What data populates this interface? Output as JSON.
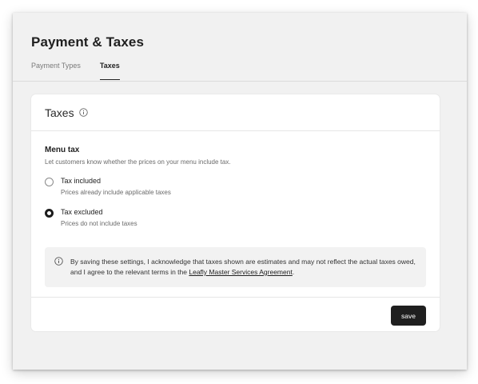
{
  "page": {
    "title": "Payment & Taxes",
    "tabs": [
      {
        "label": "Payment Types",
        "active": false
      },
      {
        "label": "Taxes",
        "active": true
      }
    ]
  },
  "card": {
    "title": "Taxes",
    "title_icon": "info-icon",
    "section": {
      "title": "Menu tax",
      "description": "Let customers know whether the prices on your menu include tax.",
      "options": [
        {
          "label": "Tax included",
          "sub": "Prices already include applicable taxes",
          "selected": false
        },
        {
          "label": "Tax excluded",
          "sub": "Prices do not include taxes",
          "selected": true
        }
      ]
    },
    "notice": {
      "icon": "info-icon",
      "text_before": "By saving these settings, I acknowledge that taxes shown are estimates and may not reflect the actual taxes owed, and I agree to the relevant terms in the ",
      "link_text": "Leafly Master Services Agreement",
      "text_after": "."
    },
    "save_label": "save"
  },
  "colors": {
    "window_bg": "#f1f1f1",
    "card_bg": "#ffffff",
    "button_bg": "#1f1f1f",
    "notice_bg": "#f2f2f2"
  }
}
